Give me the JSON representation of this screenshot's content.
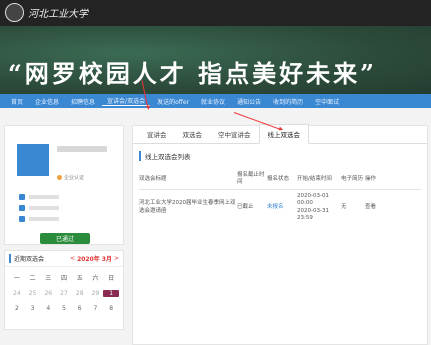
{
  "header": {
    "logo_text": "河北工业大学"
  },
  "banner": {
    "slogan": "“网罗校园人才 指点美好未来”"
  },
  "nav": {
    "items": [
      {
        "label": "首页"
      },
      {
        "label": "企业信息"
      },
      {
        "label": "招聘信息"
      },
      {
        "label": "宣讲会/双选会"
      },
      {
        "label": "发送的offer"
      },
      {
        "label": "就业协议"
      },
      {
        "label": "通知公告"
      },
      {
        "label": "收到的简历"
      },
      {
        "label": "空中面试"
      }
    ]
  },
  "company": {
    "verified_label": "企业认证",
    "passed_label": "已通过"
  },
  "calendar": {
    "title": "近期双选会",
    "year": "2020年",
    "month": "3月",
    "prev": "<",
    "next": ">",
    "day_names": [
      "一",
      "二",
      "三",
      "四",
      "五",
      "六",
      "日"
    ],
    "days": [
      "24",
      "25",
      "26",
      "27",
      "28",
      "29",
      "1",
      "2",
      "3",
      "4",
      "5",
      "6",
      "7",
      "8"
    ]
  },
  "tabs": [
    {
      "label": "宣讲会"
    },
    {
      "label": "双选会"
    },
    {
      "label": "空中宣讲会"
    },
    {
      "label": "线上双选会"
    }
  ],
  "list": {
    "title": "线上双选会列表",
    "headers": [
      "双选会标题",
      "报名截止时间",
      "报名状态",
      "开始/结束时间",
      "电子简历",
      "操作"
    ],
    "rows": [
      {
        "title": "河北工业大学2020届毕业生春季网上双选会邀请函",
        "deadline": "已截止",
        "status": "未报名",
        "start": "2020-03-01 00:00",
        "end": "2020-03-31 23:59",
        "resume": "无",
        "action": "查看"
      }
    ]
  },
  "colors": {
    "nav": "#3a87d2",
    "passed": "#2b8c3c",
    "arrow": "#e33",
    "today": "#8a2a52"
  }
}
